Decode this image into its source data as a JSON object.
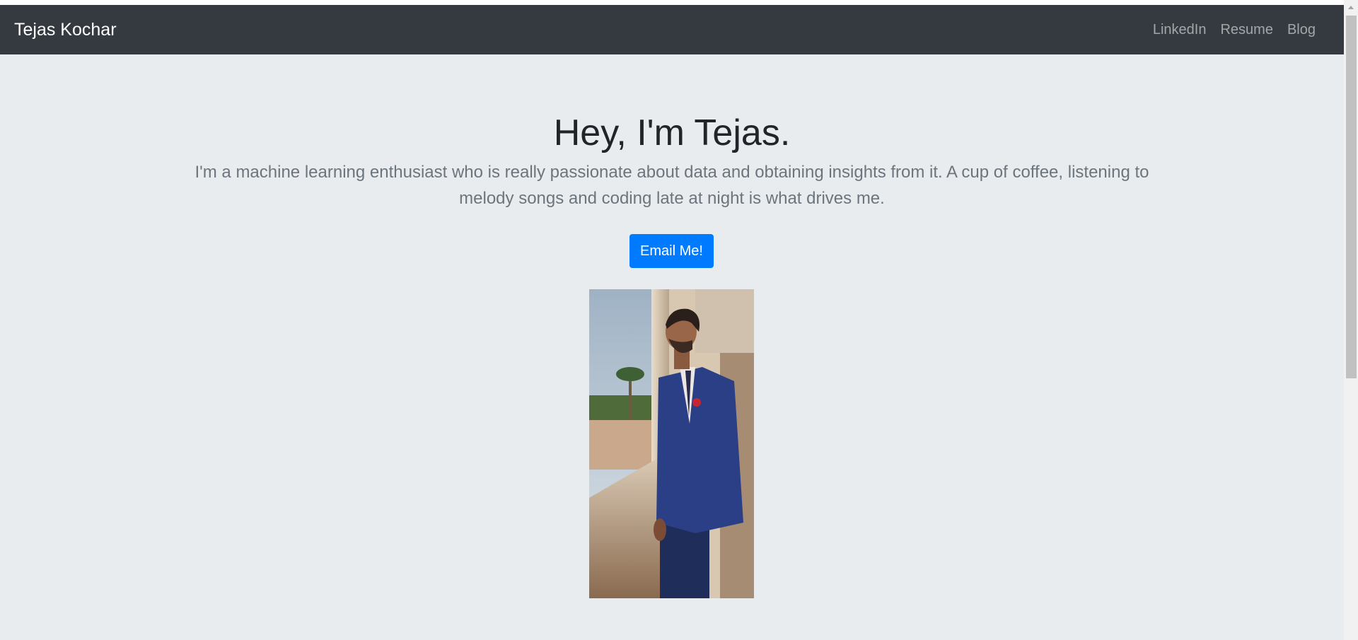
{
  "navbar": {
    "brand": "Tejas Kochar",
    "links": [
      "LinkedIn",
      "Resume",
      "Blog"
    ]
  },
  "hero": {
    "title": "Hey, I'm Tejas.",
    "lead": "I'm a machine learning enthusiast who is really passionate about data and obtaining insights from it. A cup of coffee, listening to melody songs and coding late at night is what drives me.",
    "button_label": "Email Me!"
  },
  "colors": {
    "navbar_bg": "#343a40",
    "jumbotron_bg": "#e9ecef",
    "button_bg": "#007bff"
  },
  "icons": [
    "chevron-up-icon"
  ]
}
